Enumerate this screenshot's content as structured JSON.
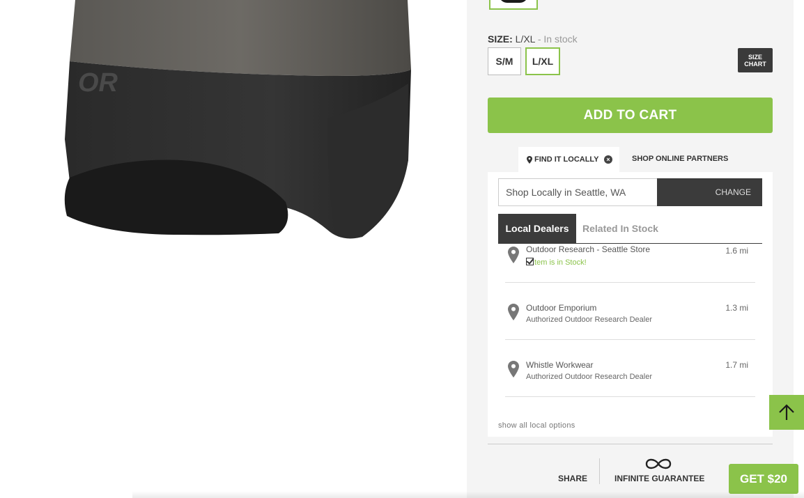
{
  "product_image": {
    "logo_text": "OR"
  },
  "size": {
    "label": "SIZE:",
    "selected": "L/XL",
    "stock_text": "- In stock",
    "options": [
      "S/M",
      "L/XL"
    ],
    "chart_line1": "SIZE",
    "chart_line2": "CHART"
  },
  "add_to_cart": "ADD TO CART",
  "tabs": {
    "find_locally": "FIND IT LOCALLY",
    "shop_online": "SHOP ONLINE PARTNERS"
  },
  "locator": {
    "input_value": "Shop Locally in Seattle, WA",
    "change_label": "CHANGE",
    "subtabs": [
      "Local Dealers",
      "Related In Stock"
    ],
    "dealers": [
      {
        "name": "Outdoor Research - Seattle Store",
        "sub": "Item is in Stock!",
        "distance": "1.6 mi"
      },
      {
        "name": "Outdoor Emporium",
        "sub": "Authorized Outdoor Research Dealer",
        "distance": "1.3 mi"
      },
      {
        "name": "Whistle Workwear",
        "sub": "Authorized Outdoor Research Dealer",
        "distance": "1.7 mi"
      }
    ],
    "show_all": "show all local options"
  },
  "footer": {
    "share": "SHARE",
    "guarantee": "INFINITE GUARANTEE"
  },
  "promo": "GET $20",
  "colors": {
    "accent": "#8bc34a",
    "dark": "#3b3b3b",
    "panel_bg": "#f4f4f4"
  }
}
